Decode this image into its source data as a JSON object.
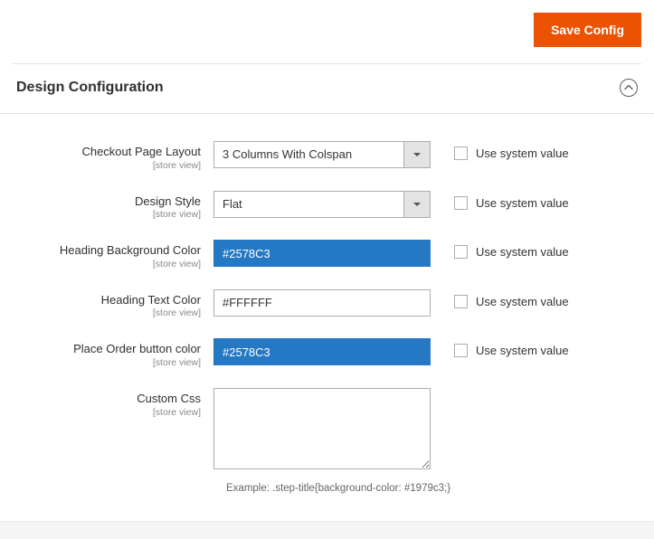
{
  "buttons": {
    "save": "Save Config"
  },
  "section": {
    "title": "Design Configuration"
  },
  "scope": "[store view]",
  "checkbox_label": "Use system value",
  "fields": {
    "layout": {
      "label": "Checkout Page Layout",
      "value": "3 Columns With Colspan"
    },
    "style": {
      "label": "Design Style",
      "value": "Flat"
    },
    "heading_bg": {
      "label": "Heading Background Color",
      "value": "#2578C3"
    },
    "heading_text": {
      "label": "Heading Text Color",
      "value": "#FFFFFF"
    },
    "place_order": {
      "label": "Place Order button color",
      "value": "#2578C3"
    },
    "custom_css": {
      "label": "Custom Css",
      "value": ""
    }
  },
  "example": "Example: .step-title{background-color: #1979c3;}"
}
